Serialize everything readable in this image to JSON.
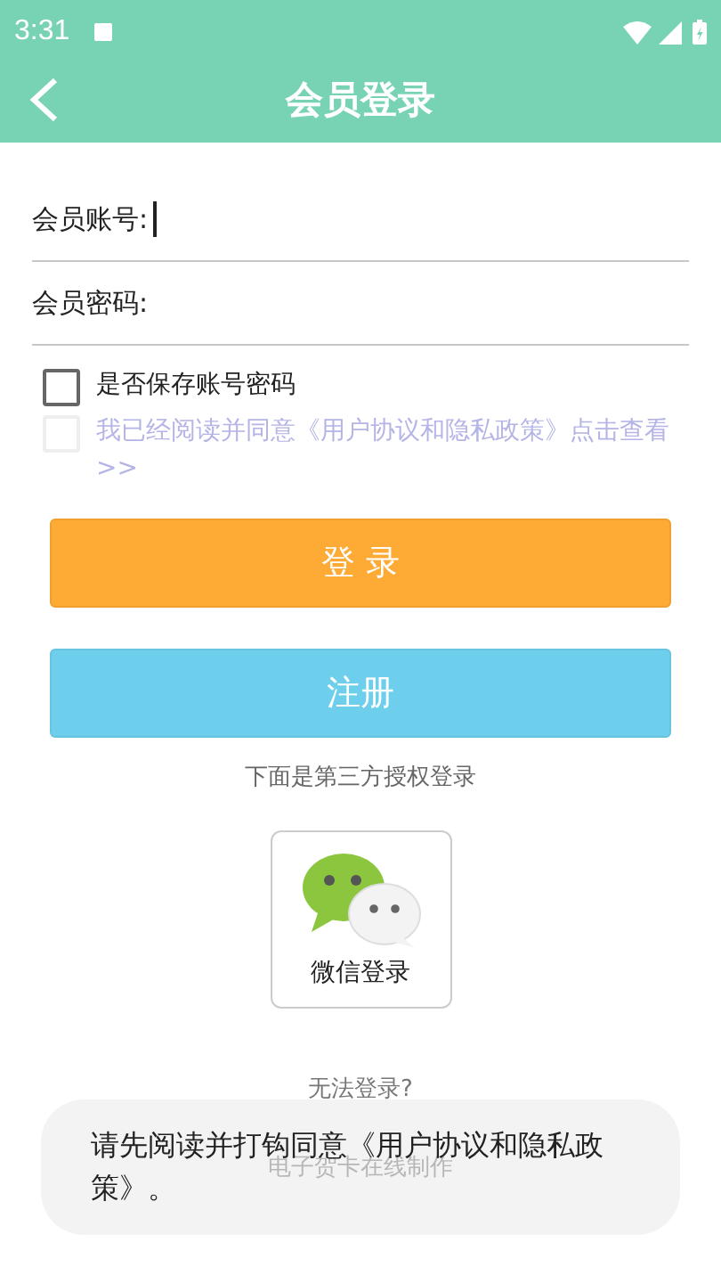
{
  "status_bar": {
    "time": "3:31"
  },
  "app_bar": {
    "title": "会员登录"
  },
  "fields": [
    {
      "label": "会员账号:",
      "focused": true
    },
    {
      "label": "会员密码:",
      "focused": false
    }
  ],
  "checkboxes": [
    {
      "label": "是否保存账号密码",
      "checked": false,
      "disabled": false
    },
    {
      "label": "我已经阅读并同意《用户协议和隐私政策》点击查看>>",
      "checked": false,
      "disabled": true
    }
  ],
  "buttons": [
    {
      "label": "登 录",
      "kind": "login"
    },
    {
      "label": "注册",
      "kind": "register"
    }
  ],
  "third_party": {
    "caption": "下面是第三方授权登录",
    "wechat_label": "微信登录"
  },
  "cannot_login": "无法登录?",
  "footer": "电子贺卡在线制作",
  "toast": "请先阅读并打钩同意《用户协议和隐私政策》。"
}
